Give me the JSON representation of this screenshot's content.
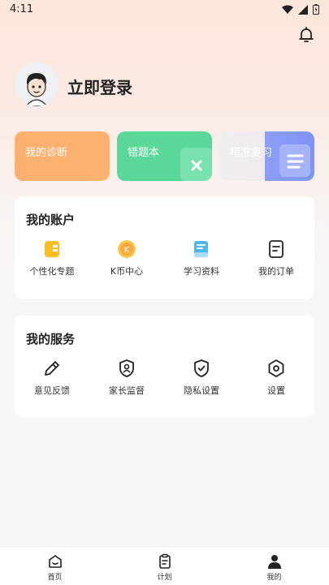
{
  "status": {
    "time": "4:11"
  },
  "profile": {
    "login_text": "立即登录"
  },
  "quick_cards": [
    {
      "label": "我的诊断",
      "color": "#fdb16f"
    },
    {
      "label": "错题本",
      "color": "#59d89a"
    },
    {
      "label": "精准复习",
      "color": "#7e93f4"
    }
  ],
  "account": {
    "title": "我的账户",
    "items": [
      {
        "label": "个性化专题",
        "icon": "notebook-icon"
      },
      {
        "label": "K币中心",
        "icon": "coin-icon"
      },
      {
        "label": "学习资料",
        "icon": "book-icon"
      },
      {
        "label": "我的订单",
        "icon": "order-icon"
      }
    ]
  },
  "services": {
    "title": "我的服务",
    "items": [
      {
        "label": "意见反馈",
        "icon": "pencil-icon"
      },
      {
        "label": "家长监督",
        "icon": "shield-user-icon"
      },
      {
        "label": "隐私设置",
        "icon": "shield-check-icon"
      },
      {
        "label": "设置",
        "icon": "gear-icon"
      }
    ]
  },
  "tabs": [
    {
      "label": "首页",
      "icon": "home-icon"
    },
    {
      "label": "计划",
      "icon": "clipboard-icon"
    },
    {
      "label": "我的",
      "icon": "user-icon",
      "active": true
    }
  ]
}
